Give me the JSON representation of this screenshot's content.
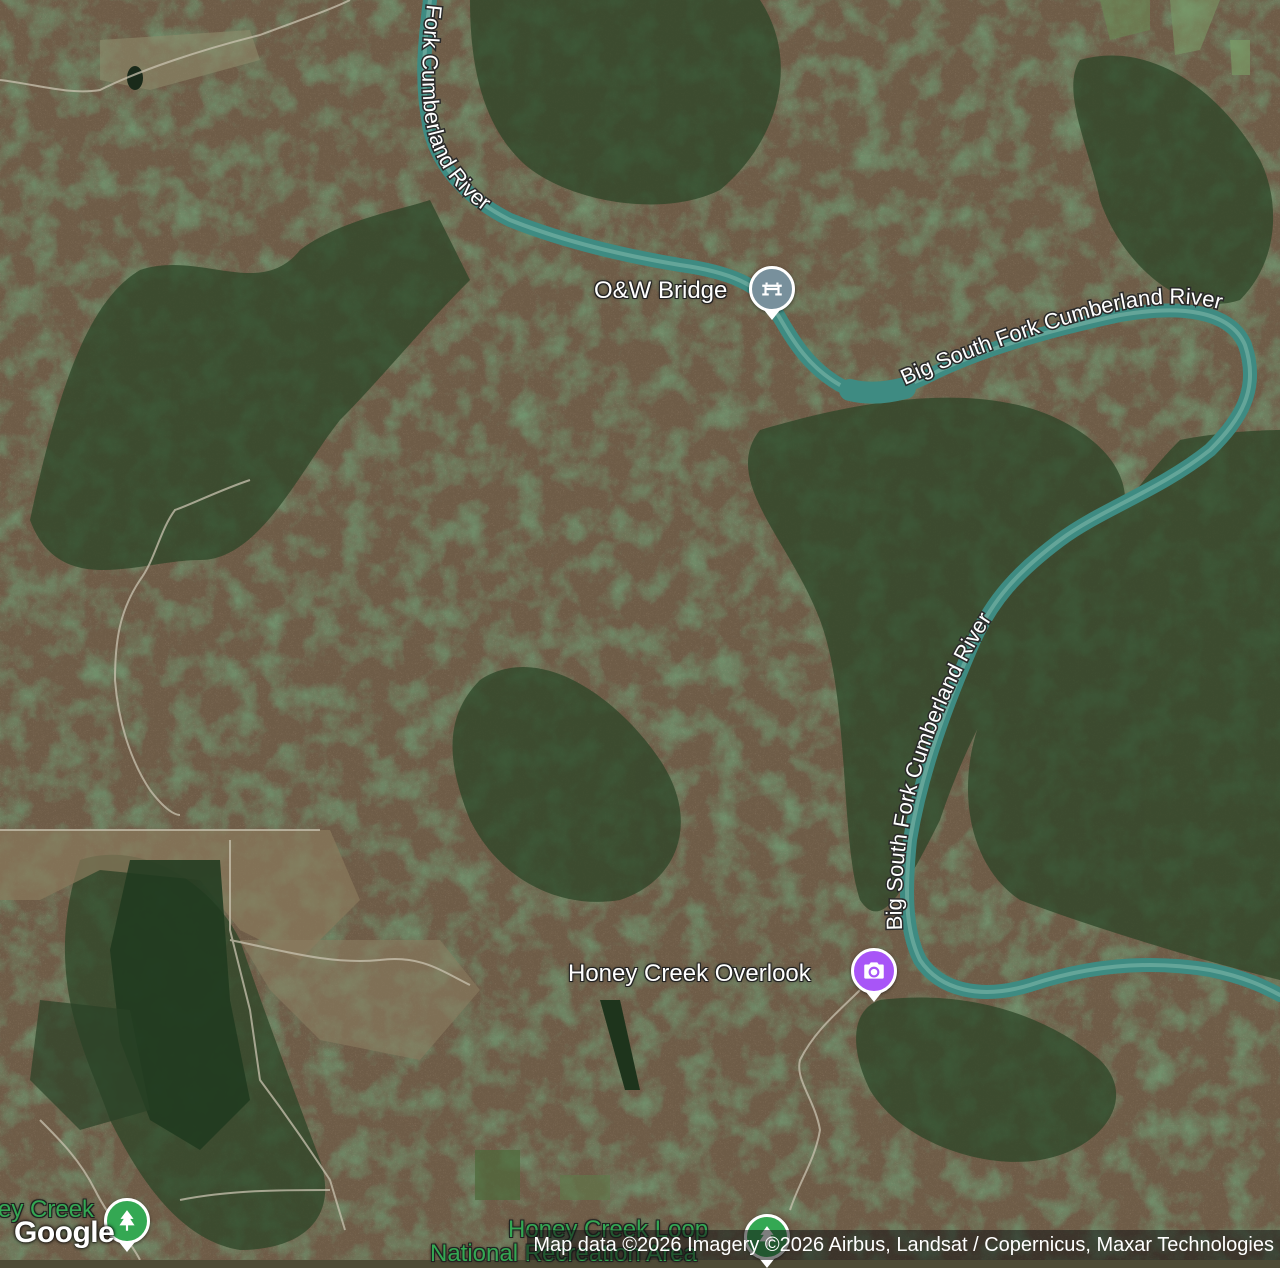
{
  "map": {
    "type": "satellite",
    "colors": {
      "forest_brown": "#6b5a45",
      "forest_green": "#2f4a2a",
      "river": "#3d8a82",
      "pin_bridge": "#78909c",
      "pin_camera": "#a855f7",
      "pin_park": "#34a853"
    },
    "rivers": [
      {
        "name": "South Fork Cumberland River",
        "label_visible": "h Fork Cumberland River"
      },
      {
        "name": "Big South Fork Cumberland River",
        "label_visible": "Big South Fork Cumberland River"
      },
      {
        "name": "Big South Fork Cumberland River 2",
        "label_visible": "Big South Fork Cumberland River"
      }
    ],
    "places": [
      {
        "label": "O&W Bridge",
        "icon": "bridge-icon"
      },
      {
        "label": "Honey Creek Overlook",
        "icon": "camera-icon"
      },
      {
        "label": "Honey Creek Loop",
        "icon": "park-icon"
      },
      {
        "label": "ey Creek",
        "icon": "park-icon"
      },
      {
        "label": "National Recreation Area",
        "icon": "none"
      }
    ],
    "logo": "Google",
    "attribution": "Map data ©2026 Imagery ©2026 Airbus, Landsat / Copernicus, Maxar Technologies"
  }
}
